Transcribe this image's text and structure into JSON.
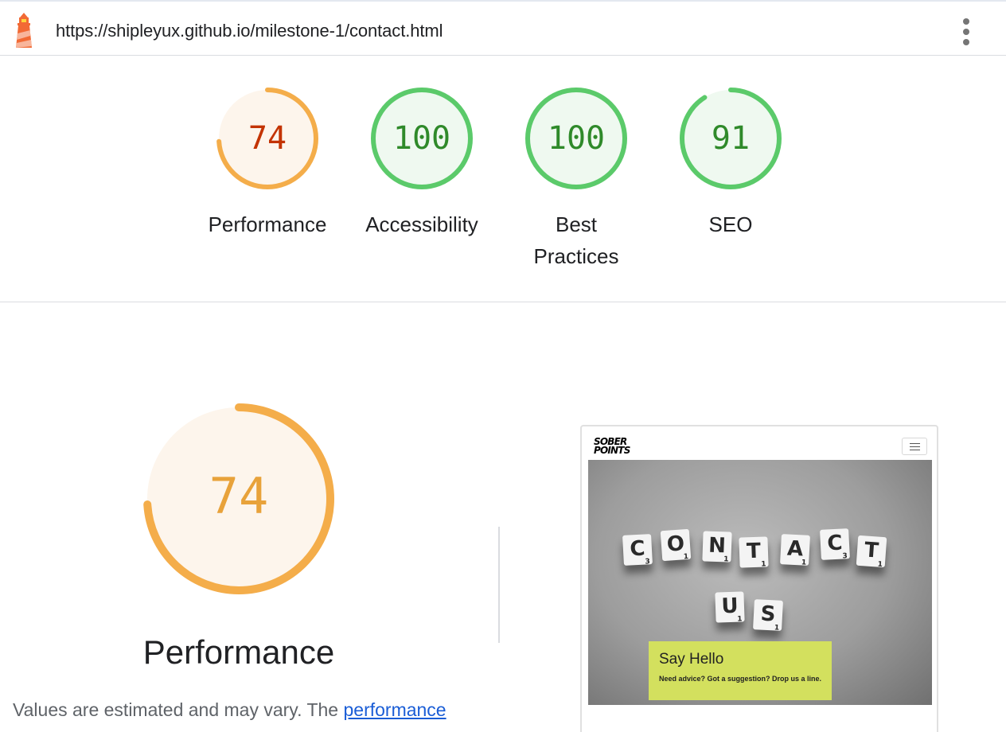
{
  "header": {
    "url": "https://shipleyux.github.io/milestone-1/contact.html",
    "logo_icon": "lighthouse-icon",
    "menu_icon": "more-vertical-icon"
  },
  "scores": [
    {
      "label": "Performance",
      "value": 74,
      "status": "average"
    },
    {
      "label": "Accessibility",
      "value": 100,
      "status": "pass"
    },
    {
      "label_line1": "Best",
      "label_line2": "Practices",
      "value": 100,
      "status": "pass"
    },
    {
      "label": "SEO",
      "value": 91,
      "status": "pass"
    }
  ],
  "colors": {
    "average_ring": "#f4ad4a",
    "average_text_small": "#c33300",
    "average_text_big": "#e8a23a",
    "average_fill": "#fdf5ec",
    "pass_ring": "#5bca6a",
    "pass_text": "#2f8a2a",
    "pass_fill": "#eff9f0"
  },
  "detail": {
    "score": 74,
    "title": "Performance",
    "description": "Values are estimated and may vary. The",
    "link_text": "performance"
  },
  "screenshot": {
    "brand_line1": "SOBER",
    "brand_line2": "POINTS",
    "nav_icon": "hamburger-menu-icon",
    "word1": [
      {
        "letter": "C",
        "points": "3"
      },
      {
        "letter": "O",
        "points": "1"
      },
      {
        "letter": "N",
        "points": "1"
      },
      {
        "letter": "T",
        "points": "1"
      },
      {
        "letter": "A",
        "points": "1"
      },
      {
        "letter": "C",
        "points": "3"
      },
      {
        "letter": "T",
        "points": "1"
      }
    ],
    "word2": [
      {
        "letter": "U",
        "points": "1"
      },
      {
        "letter": "S",
        "points": "1"
      }
    ],
    "banner_title": "Say Hello",
    "banner_subtitle": "Need advice? Got a suggestion? Drop us a line."
  }
}
